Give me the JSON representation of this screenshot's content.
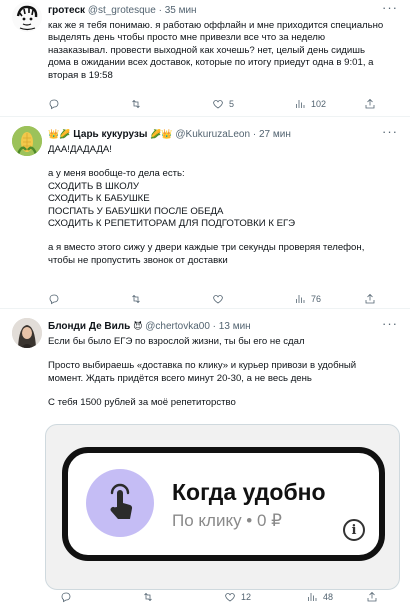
{
  "colors": {
    "text": "#0f1419",
    "muted": "#536471",
    "divider": "#eff3f4",
    "card_accent": "#c5bdf5"
  },
  "tweets": [
    {
      "name": "гротеск",
      "handle": "@st_grotesque",
      "sep": "·",
      "time": "35 мин",
      "text": "как же я тебя понимаю. я работаю оффлайн и мне приходится специально\nвыделять день чтобы просто мне привезли все что за неделю\nназаказывал. провести выходной как хочешь? нет, целый день сидишь\nдома в ожидании всех доставок, которые по итогу приедут одна в 9:01, а\nвторая в 19:58",
      "replies": "",
      "retweets": "",
      "likes": "5",
      "views": "102"
    },
    {
      "name_prefix": "👑🌽",
      "name": "Царь кукурузы",
      "name_suffix": "🌽👑",
      "handle": "@KukuruzaLeon",
      "sep": "·",
      "time": "27 мин",
      "text1": "ДАА!ДАДАДА!",
      "text2": "а у меня вообще-то дела есть:\nСХОДИТЬ В ШКОЛУ\nСХОДИТЬ К БАБУШКЕ\nПОСПАТЬ У БАБУШКИ ПОСЛЕ ОБЕДА\nСХОДИТЬ К РЕПЕТИТОРАМ ДЛЯ ПОДГОТОВКИ К ЕГЭ",
      "text3": "а я вместо этого сижу у двери каждые три секунды проверяя телефон,\nчтобы не пропустить звонок от доставки",
      "replies": "",
      "retweets": "",
      "likes": "",
      "views": "76"
    },
    {
      "name": "Блонди Де Виль",
      "name_suffix": "😈",
      "handle": "@chertovka00",
      "sep": "·",
      "time": "13 мин",
      "text1": "Если бы было ЕГЭ по взрослой жизни, ты бы его не сдал",
      "text2": "Просто выбираешь «доставка по клику» и курьер привози в удобный\nмомент. Ждать придётся всего минут 20-30, а не весь день",
      "text3": "С тебя 1500 рублей за моё репетиторство",
      "card": {
        "title": "Когда удобно",
        "subtitle": "По клику • 0 ₽",
        "info": "i"
      },
      "replies": "",
      "retweets": "",
      "likes": "12",
      "views": "48"
    }
  ]
}
